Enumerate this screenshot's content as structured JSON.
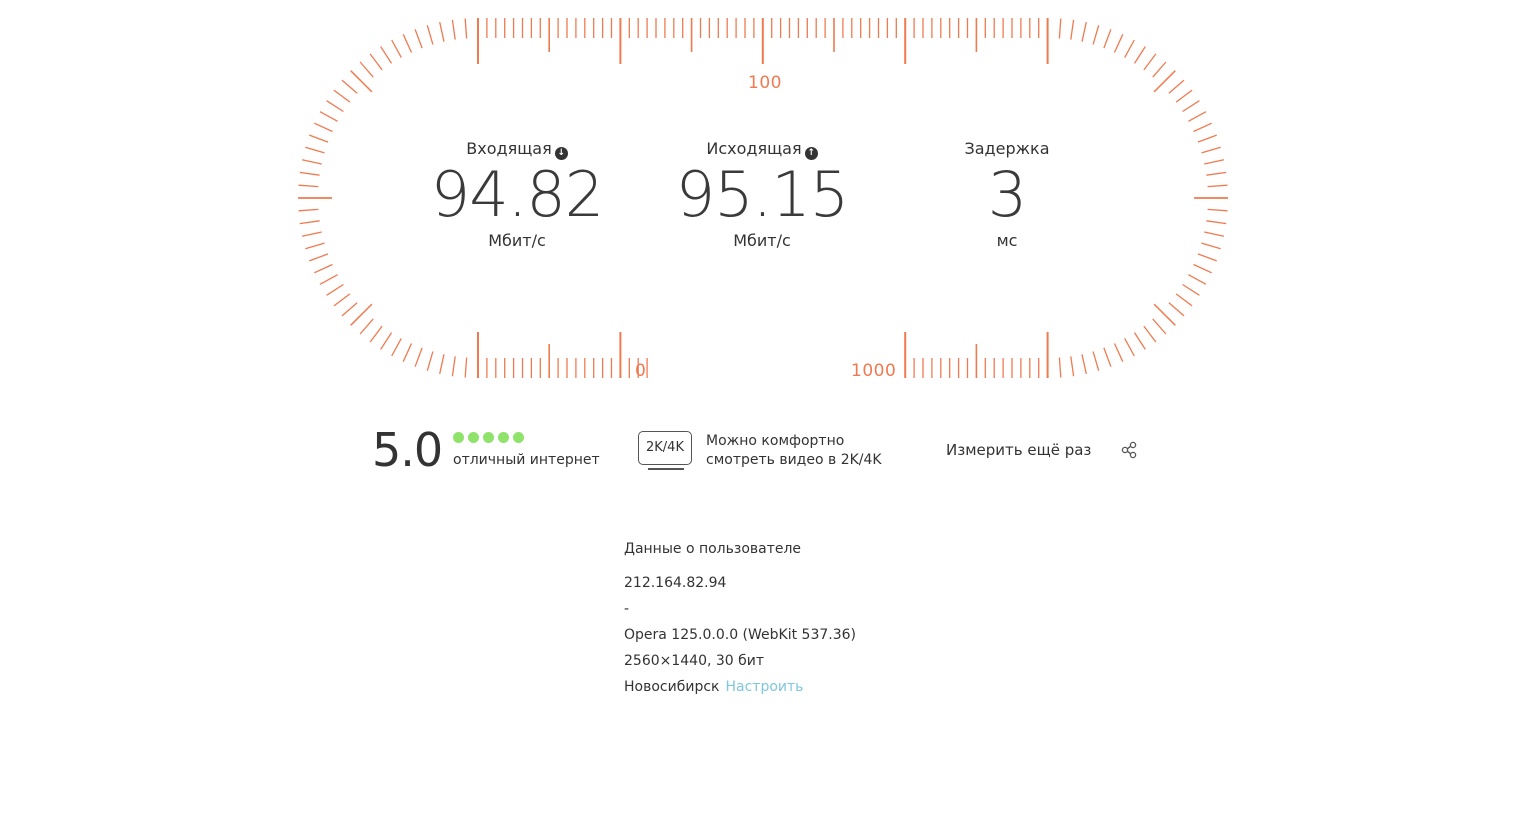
{
  "gauge": {
    "accent_color": "#f07a50",
    "labels": {
      "top": "100",
      "bottom_left": "0",
      "bottom_right": "1000"
    }
  },
  "metrics": {
    "download": {
      "title": "Входящая",
      "icon": "arrow-down-icon",
      "value": "94.82",
      "unit": "Мбит/с"
    },
    "upload": {
      "title": "Исходящая",
      "icon": "arrow-up-icon",
      "value": "95.15",
      "unit": "Мбит/с"
    },
    "latency": {
      "title": "Задержка",
      "value": "3",
      "unit": "мс"
    }
  },
  "rating": {
    "score": "5.0",
    "stars": 5,
    "star_color": "#8fe26a",
    "text": "отличный интернет"
  },
  "video": {
    "badge": "2K/4K",
    "line1": "Можно комфортно",
    "line2": "смотреть видео в 2K/4K"
  },
  "actions": {
    "retest": "Измерить ещё раз",
    "share_icon": "share-icon"
  },
  "user": {
    "heading": "Данные о пользователе",
    "ip": "212.164.82.94",
    "provider": "-",
    "browser": "Opera 125.0.0.0 (WebKit 537.36)",
    "screen": "2560×1440, 30 бит",
    "city": "Новосибирск",
    "configure": "Настроить",
    "link_color": "#7fc6de"
  }
}
